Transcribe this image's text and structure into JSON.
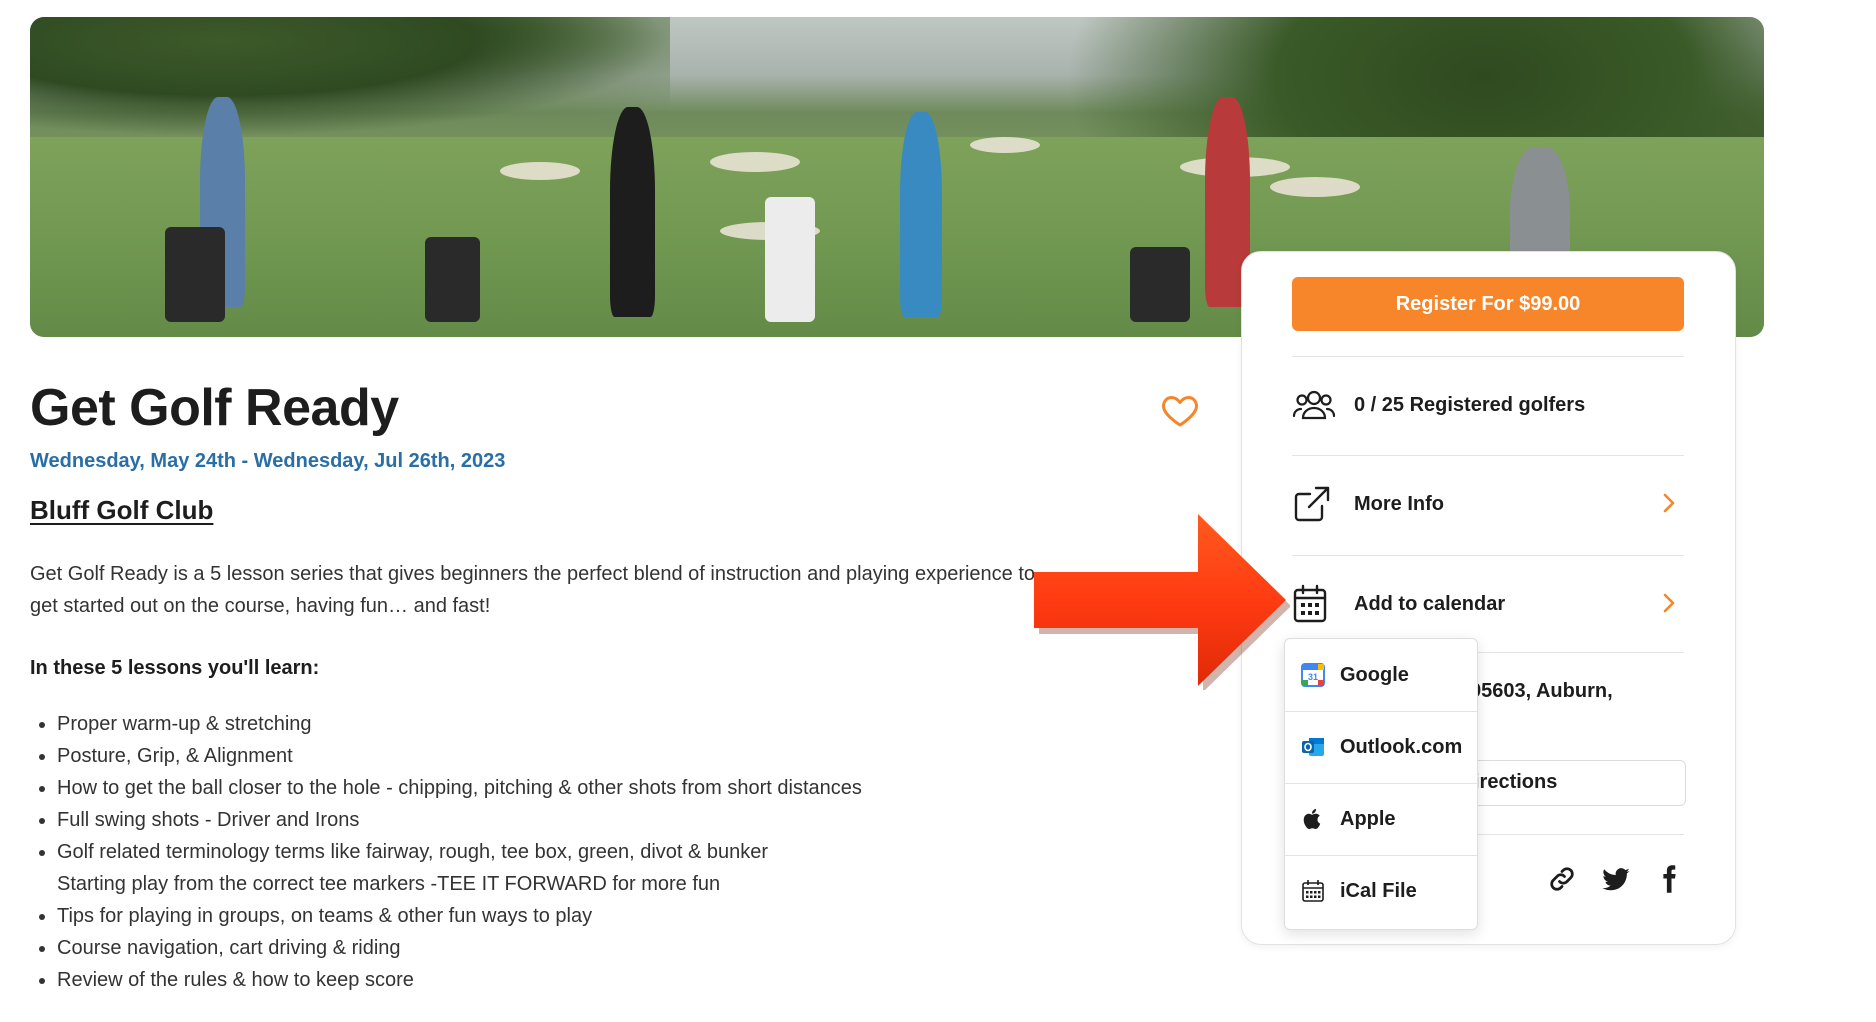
{
  "hero": {
    "alt": "Golfers practicing swings on a driving range"
  },
  "event": {
    "title": "Get Golf Ready",
    "dates": "Wednesday, May 24th - Wednesday, Jul 26th, 2023",
    "club": "Bluff Golf Club",
    "description": "Get Golf Ready is a 5 lesson series that gives beginners the perfect blend of instruction and playing experience to get started out on the course, having fun… and fast!",
    "learn_heading": "In these 5 lessons you'll learn:",
    "learn_items": [
      "Proper warm-up & stretching",
      "Posture, Grip, & Alignment",
      "How to get the ball closer to the hole - chipping, pitching & other shots from short distances",
      "Full swing shots - Driver and Irons",
      "Golf related terminology terms like fairway, rough, tee box, green, divot & bunker",
      "Starting play from the correct tee markers -TEE IT FORWARD for more fun",
      "Tips for playing in groups, on teams & other fun ways to play",
      "Course navigation, cart driving & riding",
      "Review of the rules & how to keep score"
    ]
  },
  "sidebar": {
    "register_label": "Register For $99.00",
    "registered": "0 / 25 Registered golfers",
    "more_info": "More Info",
    "add_to_calendar": "Add to calendar",
    "address_partial": "95603, Auburn,",
    "directions_partial": "irections"
  },
  "calendar_menu": {
    "items": [
      {
        "label": "Google",
        "icon": "google-calendar-icon"
      },
      {
        "label": "Outlook.com",
        "icon": "outlook-icon"
      },
      {
        "label": "Apple",
        "icon": "apple-icon"
      },
      {
        "label": "iCal File",
        "icon": "ical-icon"
      }
    ]
  },
  "colors": {
    "accent": "#f7862a",
    "date_blue": "#2a6ea6",
    "arrow_red": "#ff3b12"
  }
}
